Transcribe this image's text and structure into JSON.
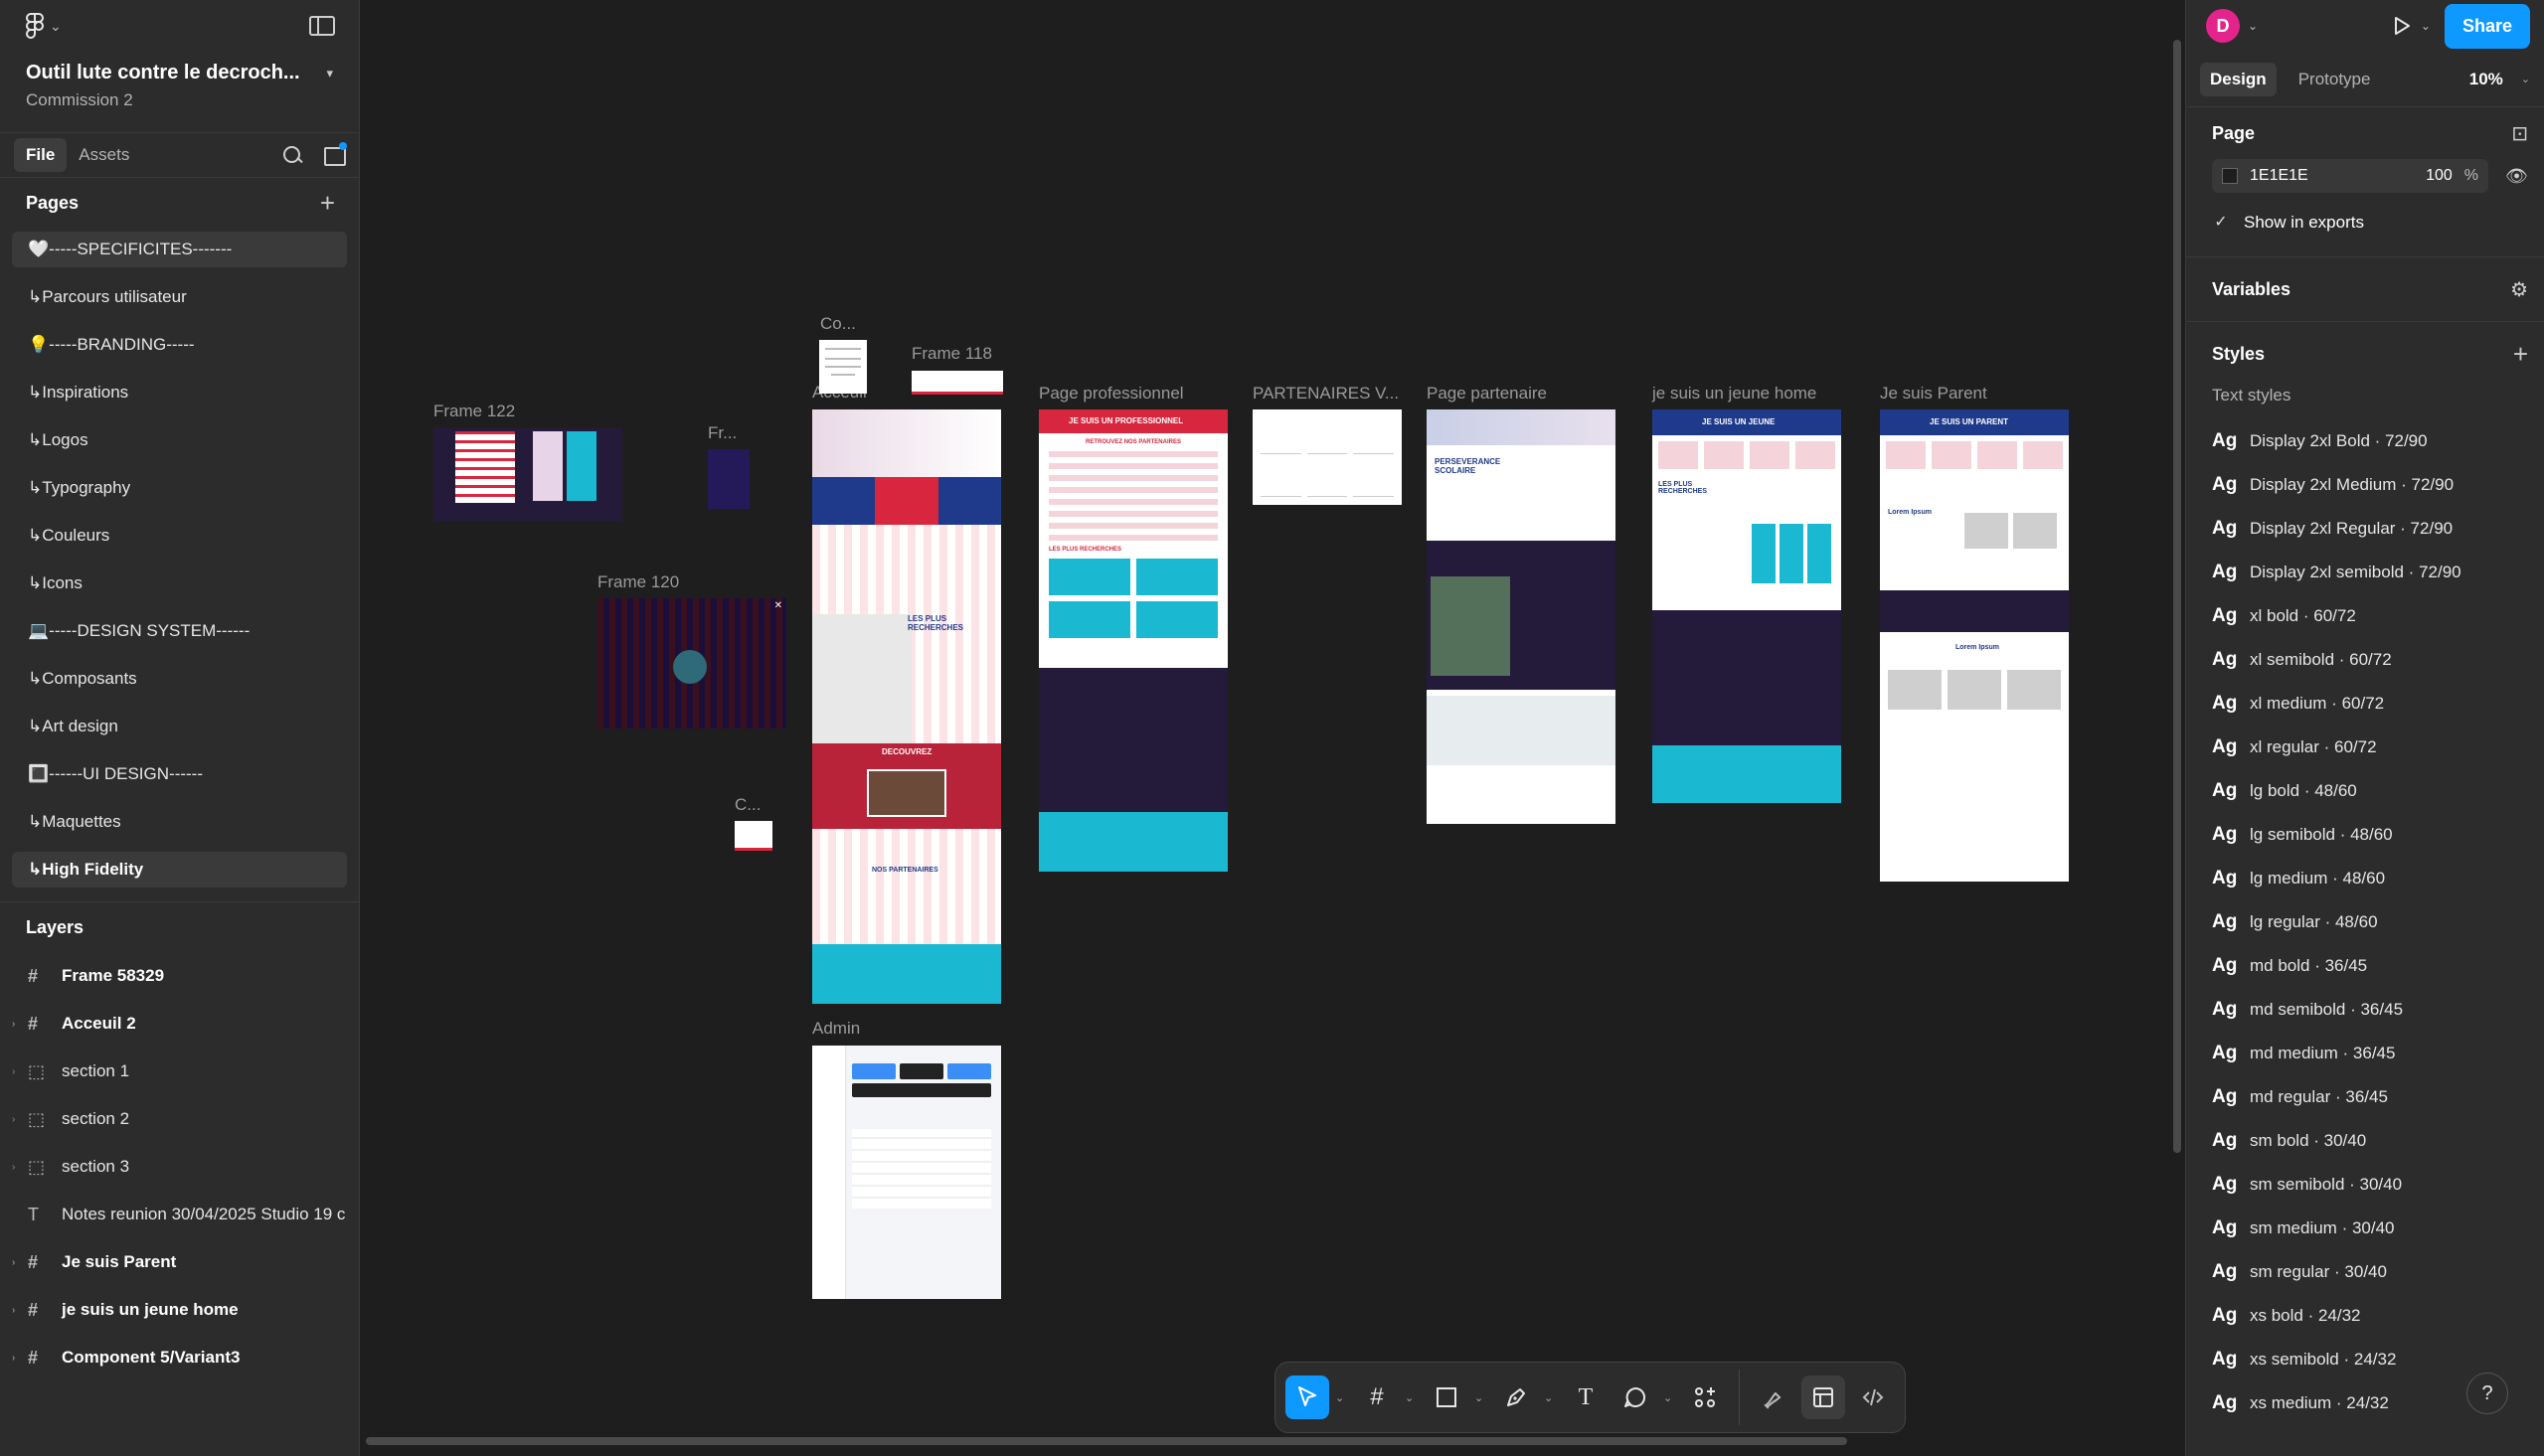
{
  "file": {
    "title": "Outil lute contre le decroch...",
    "project": "Commission 2"
  },
  "left_tabs": [
    "File",
    "Assets"
  ],
  "pages": {
    "heading": "Pages",
    "items": [
      {
        "label": "🤍-----SPECIFICITES-------",
        "current": true
      },
      {
        "label": "↳Parcours utilisateur"
      },
      {
        "label": "💡-----BRANDING-----"
      },
      {
        "label": "↳Inspirations"
      },
      {
        "label": "↳Logos"
      },
      {
        "label": "↳Typography"
      },
      {
        "label": "↳Couleurs"
      },
      {
        "label": "↳Icons"
      },
      {
        "label": "💻-----DESIGN SYSTEM------"
      },
      {
        "label": "↳Composants"
      },
      {
        "label": "↳Art design"
      },
      {
        "label": "🔳------UI DESIGN------"
      },
      {
        "label": "↳Maquettes"
      },
      {
        "label": "↳High Fidelity",
        "selected": true
      }
    ]
  },
  "layers": {
    "heading": "Layers",
    "items": [
      {
        "label": "Frame 58329",
        "icon": "frame-icon",
        "bold": true,
        "caret": false
      },
      {
        "label": "Acceuil 2",
        "icon": "frame-icon",
        "bold": true,
        "caret": true
      },
      {
        "label": "section 1",
        "icon": "section-icon",
        "bold": false,
        "caret": true
      },
      {
        "label": "section 2",
        "icon": "section-icon",
        "bold": false,
        "caret": true
      },
      {
        "label": "section 3",
        "icon": "section-icon",
        "bold": false,
        "caret": true
      },
      {
        "label": "Notes reunion 30/04/2025 Studio 19 c",
        "icon": "text-icon",
        "bold": false,
        "caret": false
      },
      {
        "label": "Je suis Parent",
        "icon": "frame-icon",
        "bold": true,
        "caret": true
      },
      {
        "label": "je suis un jeune home",
        "icon": "frame-icon",
        "bold": true,
        "caret": true
      },
      {
        "label": "Component 5/Variant3",
        "icon": "frame-icon",
        "bold": true,
        "caret": true
      }
    ]
  },
  "canvas": {
    "frame_labels": {
      "co": "Co...",
      "frame118": "Frame 118",
      "acceuil": "Acceuil",
      "page_pro": "Page professionnel",
      "partenaires_v": "PARTENAIRES V...",
      "page_partenaire": "Page partenaire",
      "jeune": "je suis un jeune home",
      "parent": "Je suis Parent",
      "frame122": "Frame 122",
      "fr": "Fr...",
      "frame120": "Frame 120",
      "c": "C...",
      "admin": "Admin"
    },
    "mock_text": {
      "pro_banner": "JE SUIS UN PROFESSIONNEL",
      "retrouvez": "RETROUVEZ NOS PARTENAIRES",
      "plus_recherches": "LES PLUS RECHERCHES",
      "decouvrez": "DECOUVREZ",
      "nos_partenaires": "NOS PARTENAIRES",
      "perseverance": "PERSEVERANCE SCOLAIRE",
      "jeune_banner": "JE SUIS UN JEUNE",
      "parent_banner": "JE SUIS UN PARENT",
      "lorem": "Lorem Ipsum"
    }
  },
  "toolbar": {
    "tools": [
      {
        "name": "move-tool",
        "active": true
      },
      {
        "name": "frame-tool"
      },
      {
        "name": "shape-tool"
      },
      {
        "name": "pen-tool"
      },
      {
        "name": "text-tool"
      },
      {
        "name": "comment-tool"
      },
      {
        "name": "actions-tool"
      }
    ]
  },
  "right": {
    "avatar_initial": "D",
    "share_label": "Share",
    "tabs": [
      "Design",
      "Prototype"
    ],
    "zoom": "10%",
    "page": {
      "heading": "Page",
      "color_hex": "1E1E1E",
      "opacity": "100",
      "percent_sign": "%",
      "show_in_exports": "Show in exports"
    },
    "variables_heading": "Variables",
    "styles_heading": "Styles",
    "text_styles_label": "Text styles",
    "text_styles": [
      "Display 2xl Bold · 72/90",
      "Display 2xl Medium · 72/90",
      "Display 2xl Regular · 72/90",
      "Display 2xl semibold · 72/90",
      "xl bold · 60/72",
      "xl semibold · 60/72",
      "xl medium · 60/72",
      "xl regular · 60/72",
      "lg bold · 48/60",
      "lg semibold · 48/60",
      "lg medium · 48/60",
      "lg regular · 48/60",
      "md bold · 36/45",
      "md semibold · 36/45",
      "md medium · 36/45",
      "md regular · 36/45",
      "sm bold · 30/40",
      "sm semibold · 30/40",
      "sm medium · 30/40",
      "sm regular · 30/40",
      "xs bold · 24/32",
      "xs semibold · 24/32",
      "xs medium · 24/32"
    ],
    "ag": "Ag",
    "help": "?"
  },
  "colors": {
    "accent": "#0d99ff",
    "canvas_bg": "#1e1e1e",
    "panel_bg": "#2c2c2c",
    "brand_red": "#d7263d",
    "brand_navy": "#1f3a8a",
    "brand_cyan": "#1bb9d1",
    "dark_purple": "#241a3a"
  }
}
